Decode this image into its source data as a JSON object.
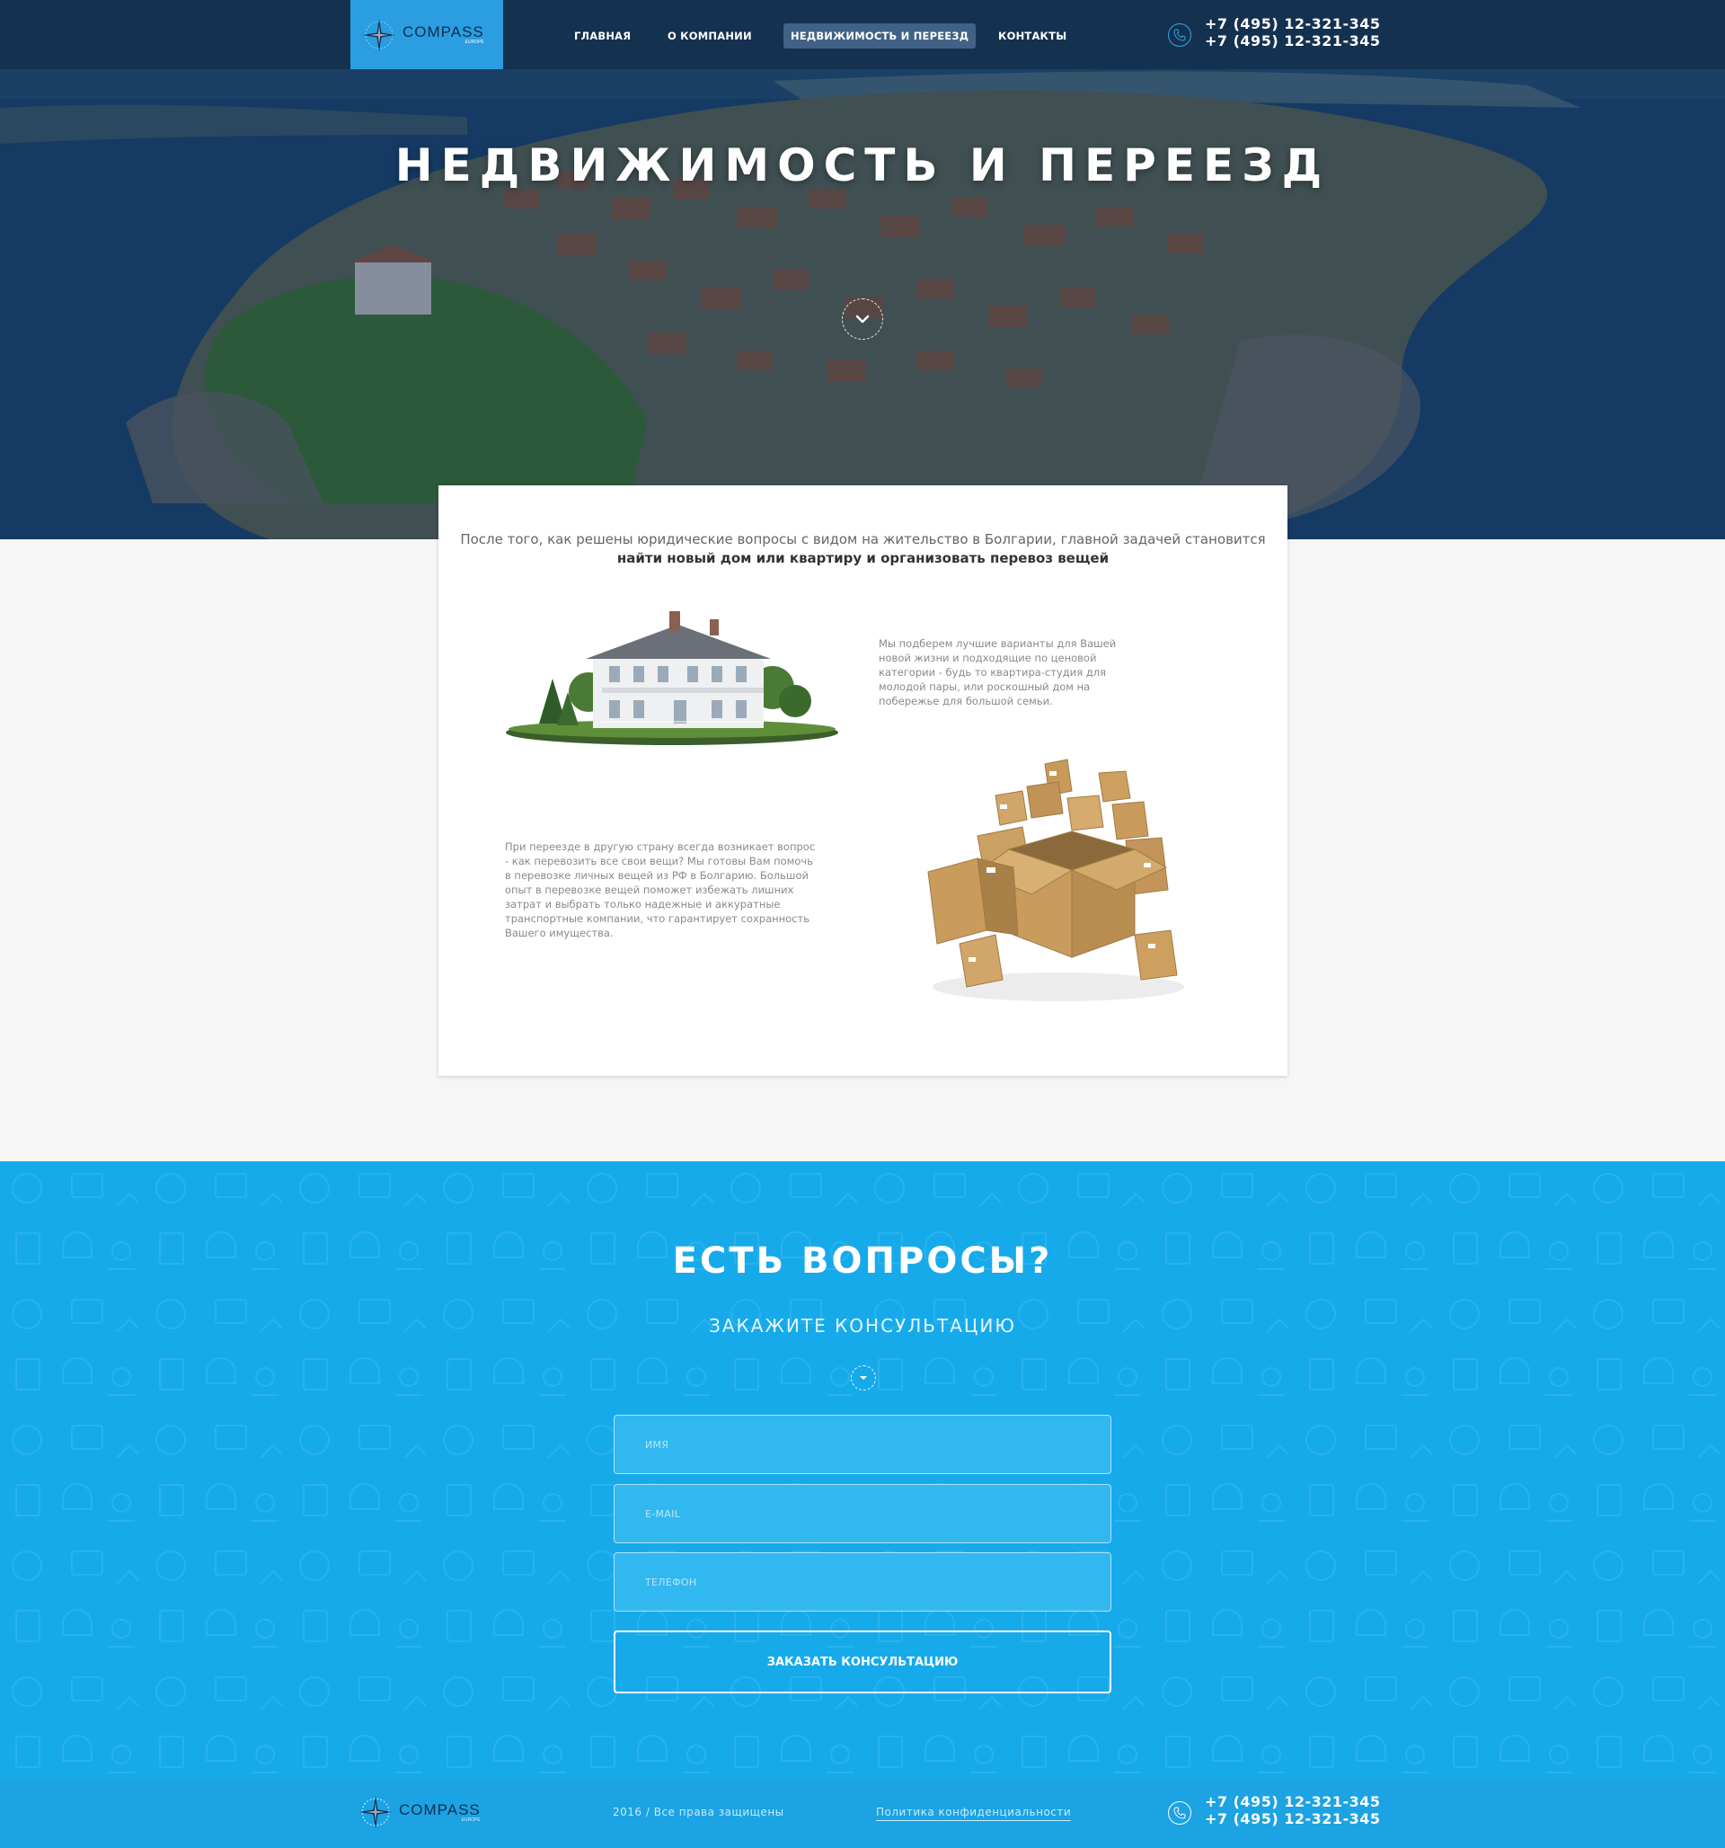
{
  "header": {
    "logo_text": "COMPASS",
    "logo_subtext": "EUROPE",
    "nav": [
      {
        "label": "ГЛАВНАЯ"
      },
      {
        "label": "О КОМПАНИИ"
      },
      {
        "label": "НЕДВИЖИМОСТЬ И ПЕРЕЕЗД"
      },
      {
        "label": "КОНТАКТЫ"
      }
    ],
    "phones": [
      "+7 (495) 12-321-345",
      "+7 (495) 12-321-345"
    ]
  },
  "hero": {
    "title": "НЕДВИЖИМОСТЬ И ПЕРЕЕЗД"
  },
  "content": {
    "intro_text": "После того, как решены юридические вопросы с видом на жительство в Болгарии, главной задачей становится",
    "intro_bold": "найти новый дом или квартиру и организовать перевоз вещей",
    "paragraph_housing": "Мы подберем лучшие варианты для Вашей новой жизни и подходящие по ценовой категории - будь то квартира-студия для молодой пары, или роскошный дом на побережье для большой семьи.",
    "paragraph_moving": "При переезде в другую страну всегда возникает вопрос - как перевозить все свои вещи? Мы готовы Вам помочь в перевозке личных вещей из РФ в Болгарию. Большой опыт в перевозке вещей поможет избежать лишних затрат и выбрать только надежные и аккуратные транспортные компании, что гарантирует сохранность Вашего имущества."
  },
  "cta": {
    "title": "ЕСТЬ ВОПРОСЫ?",
    "subtitle": "ЗАКАЖИТЕ КОНСУЛЬТАЦИЮ",
    "name_placeholder": "ИМЯ",
    "email_placeholder": "E-MAIL",
    "phone_placeholder": "ТЕЛЕФОН",
    "submit_label": "ЗАКАЗАТЬ КОНСУЛЬТАЦИЮ"
  },
  "footer": {
    "logo_text": "COMPASS",
    "logo_subtext": "EUROPE",
    "copyright": "2016 / Все права защищены",
    "policy_link": "Политика конфиденциальности",
    "phones": [
      "+7 (495) 12-321-345",
      "+7 (495) 12-321-345"
    ]
  },
  "colors": {
    "accent": "#16aaea",
    "logo_bg": "#2a9ee0",
    "hero_dark": "#16314f"
  }
}
